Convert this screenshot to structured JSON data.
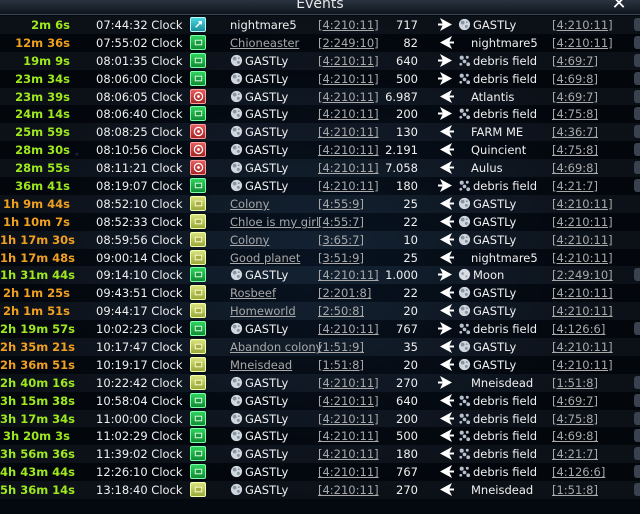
{
  "window": {
    "title": "Events"
  },
  "icons": {
    "close": "close-icon",
    "planet": "planet-icon",
    "debris": "debris-field-icon",
    "moon": "moon-icon",
    "direction": "fleet-direction-icon"
  },
  "colors": {
    "remain_green": "#9ee81e",
    "remain_orange": "#f0a020",
    "link_gray": "#a8a8a8"
  },
  "events": [
    {
      "remain": "2m 6s",
      "color": "green",
      "time": "07:44:32 Clock",
      "mission": "teal",
      "origin": "nightmare5",
      "origin_link": false,
      "origin_icon": false,
      "origin_coord": "[4:210:11]",
      "ships": "717",
      "dir": "out",
      "target": "GASTLy",
      "target_icon": "planet",
      "target_coord": "[4:210:11]",
      "btn": true
    },
    {
      "remain": "12m 36s",
      "color": "orange",
      "time": "07:55:02 Clock",
      "mission": "green",
      "origin": "Chioneaster",
      "origin_link": true,
      "origin_icon": false,
      "origin_coord": "[2:249:10]",
      "ships": "82",
      "dir": "in",
      "target": "nightmare5",
      "target_icon": "",
      "target_coord": "[4:210:11]",
      "btn": true
    },
    {
      "remain": "19m 9s",
      "color": "green",
      "time": "08:01:35 Clock",
      "mission": "green",
      "origin": "GASTLy",
      "origin_link": false,
      "origin_icon": true,
      "origin_coord": "[4:210:11]",
      "ships": "640",
      "dir": "out",
      "target": "debris field",
      "target_icon": "debris",
      "target_coord": "[4:69:7]",
      "btn": true
    },
    {
      "remain": "23m 34s",
      "color": "green",
      "time": "08:06:00 Clock",
      "mission": "green",
      "origin": "GASTLy",
      "origin_link": false,
      "origin_icon": true,
      "origin_coord": "[4:210:11]",
      "ships": "500",
      "dir": "out",
      "target": "debris field",
      "target_icon": "debris",
      "target_coord": "[4:69:8]",
      "btn": true
    },
    {
      "remain": "23m 39s",
      "color": "green",
      "time": "08:06:05 Clock",
      "mission": "red",
      "origin": "GASTLy",
      "origin_link": false,
      "origin_icon": true,
      "origin_coord": "[4:210:11]",
      "ships": "6.987",
      "dir": "in",
      "target": "Atlantis",
      "target_icon": "",
      "target_coord": "[4:69:7]",
      "btn": true
    },
    {
      "remain": "24m 14s",
      "color": "green",
      "time": "08:06:40 Clock",
      "mission": "green",
      "origin": "GASTLy",
      "origin_link": false,
      "origin_icon": true,
      "origin_coord": "[4:210:11]",
      "ships": "200",
      "dir": "out",
      "target": "debris field",
      "target_icon": "debris",
      "target_coord": "[4:75:8]",
      "btn": true
    },
    {
      "remain": "25m 59s",
      "color": "green",
      "time": "08:08:25 Clock",
      "mission": "red",
      "origin": "GASTLy",
      "origin_link": false,
      "origin_icon": true,
      "origin_coord": "[4:210:11]",
      "ships": "130",
      "dir": "in",
      "target": "FARM ME",
      "target_icon": "",
      "target_coord": "[4:36:7]",
      "btn": true
    },
    {
      "remain": "28m 30s",
      "color": "green",
      "time": "08:10:56 Clock",
      "mission": "red",
      "origin": "GASTLy",
      "origin_link": false,
      "origin_icon": true,
      "origin_coord": "[4:210:11]",
      "ships": "2.191",
      "dir": "in",
      "target": "Quincient",
      "target_icon": "",
      "target_coord": "[4:75:8]",
      "btn": true
    },
    {
      "remain": "28m 55s",
      "color": "green",
      "time": "08:11:21 Clock",
      "mission": "red",
      "origin": "GASTLy",
      "origin_link": false,
      "origin_icon": true,
      "origin_coord": "[4:210:11]",
      "ships": "7.058",
      "dir": "in",
      "target": "Aulus",
      "target_icon": "",
      "target_coord": "[4:69:8]",
      "btn": true
    },
    {
      "remain": "36m 41s",
      "color": "green",
      "time": "08:19:07 Clock",
      "mission": "green",
      "origin": "GASTLy",
      "origin_link": false,
      "origin_icon": true,
      "origin_coord": "[4:210:11]",
      "ships": "180",
      "dir": "out",
      "target": "debris field",
      "target_icon": "debris",
      "target_coord": "[4:21:7]",
      "btn": true
    },
    {
      "remain": "1h 9m 44s",
      "color": "orange",
      "time": "08:52:10 Clock",
      "mission": "yellow",
      "origin": "Colony",
      "origin_link": true,
      "origin_icon": false,
      "origin_coord": "[4:55:9]",
      "ships": "25",
      "dir": "in",
      "target": "GASTLy",
      "target_icon": "planet",
      "target_coord": "[4:210:11]",
      "btn": false
    },
    {
      "remain": "1h 10m 7s",
      "color": "orange",
      "time": "08:52:33 Clock",
      "mission": "yellow",
      "origin": "Chloe is my girl",
      "origin_link": true,
      "origin_icon": false,
      "origin_coord": "[4:55:7]",
      "ships": "22",
      "dir": "in",
      "target": "GASTLy",
      "target_icon": "planet",
      "target_coord": "[4:210:11]",
      "btn": false
    },
    {
      "remain": "1h 17m 30s",
      "color": "orange",
      "time": "08:59:56 Clock",
      "mission": "yellow",
      "origin": "Colony",
      "origin_link": true,
      "origin_icon": false,
      "origin_coord": "[3:65:7]",
      "ships": "10",
      "dir": "in",
      "target": "GASTLy",
      "target_icon": "planet",
      "target_coord": "[4:210:11]",
      "btn": false
    },
    {
      "remain": "1h 17m 48s",
      "color": "orange",
      "time": "09:00:14 Clock",
      "mission": "yellow",
      "origin": "Good planet",
      "origin_link": true,
      "origin_icon": false,
      "origin_coord": "[3:51:9]",
      "ships": "25",
      "dir": "in",
      "target": "nightmare5",
      "target_icon": "",
      "target_coord": "[4:210:11]",
      "btn": false
    },
    {
      "remain": "1h 31m 44s",
      "color": "green",
      "time": "09:14:10 Clock",
      "mission": "green",
      "origin": "GASTLy",
      "origin_link": false,
      "origin_icon": true,
      "origin_coord": "[4:210:11]",
      "ships": "1.000",
      "dir": "out",
      "target": "Moon",
      "target_icon": "moon",
      "target_coord": "[2:249:10]",
      "btn": true
    },
    {
      "remain": "2h 1m 25s",
      "color": "orange",
      "time": "09:43:51 Clock",
      "mission": "yellow",
      "origin": "Rosbeef",
      "origin_link": true,
      "origin_icon": false,
      "origin_coord": "[2:201:8]",
      "ships": "22",
      "dir": "in",
      "target": "GASTLy",
      "target_icon": "planet",
      "target_coord": "[4:210:11]",
      "btn": false
    },
    {
      "remain": "2h 1m 51s",
      "color": "orange",
      "time": "09:44:17 Clock",
      "mission": "yellow",
      "origin": "Homeworld",
      "origin_link": true,
      "origin_icon": false,
      "origin_coord": "[2:50:8]",
      "ships": "20",
      "dir": "in",
      "target": "GASTLy",
      "target_icon": "planet",
      "target_coord": "[4:210:11]",
      "btn": false
    },
    {
      "remain": "2h 19m 57s",
      "color": "green",
      "time": "10:02:23 Clock",
      "mission": "green",
      "origin": "GASTLy",
      "origin_link": false,
      "origin_icon": true,
      "origin_coord": "[4:210:11]",
      "ships": "767",
      "dir": "out",
      "target": "debris field",
      "target_icon": "debris",
      "target_coord": "[4:126:6]",
      "btn": true
    },
    {
      "remain": "2h 35m 21s",
      "color": "orange",
      "time": "10:17:47 Clock",
      "mission": "yellow",
      "origin": "Abandon colony",
      "origin_link": true,
      "origin_icon": false,
      "origin_coord": "[1:51:9]",
      "ships": "35",
      "dir": "in",
      "target": "GASTLy",
      "target_icon": "planet",
      "target_coord": "[4:210:11]",
      "btn": false
    },
    {
      "remain": "2h 36m 51s",
      "color": "orange",
      "time": "10:19:17 Clock",
      "mission": "yellow",
      "origin": "Mneisdead",
      "origin_link": true,
      "origin_icon": false,
      "origin_coord": "[1:51:8]",
      "ships": "20",
      "dir": "in",
      "target": "GASTLy",
      "target_icon": "planet",
      "target_coord": "[4:210:11]",
      "btn": false
    },
    {
      "remain": "2h 40m 16s",
      "color": "green",
      "time": "10:22:42 Clock",
      "mission": "yellow",
      "origin": "GASTLy",
      "origin_link": false,
      "origin_icon": true,
      "origin_coord": "[4:210:11]",
      "ships": "270",
      "dir": "out",
      "target": "Mneisdead",
      "target_icon": "",
      "target_coord": "[1:51:8]",
      "btn": true
    },
    {
      "remain": "3h 15m 38s",
      "color": "green",
      "time": "10:58:04 Clock",
      "mission": "green",
      "origin": "GASTLy",
      "origin_link": false,
      "origin_icon": true,
      "origin_coord": "[4:210:11]",
      "ships": "640",
      "dir": "in",
      "target": "debris field",
      "target_icon": "debris",
      "target_coord": "[4:69:7]",
      "btn": true
    },
    {
      "remain": "3h 17m 34s",
      "color": "green",
      "time": "11:00:00 Clock",
      "mission": "green",
      "origin": "GASTLy",
      "origin_link": false,
      "origin_icon": true,
      "origin_coord": "[4:210:11]",
      "ships": "200",
      "dir": "in",
      "target": "debris field",
      "target_icon": "debris",
      "target_coord": "[4:75:8]",
      "btn": true
    },
    {
      "remain": "3h 20m 3s",
      "color": "green",
      "time": "11:02:29 Clock",
      "mission": "green",
      "origin": "GASTLy",
      "origin_link": false,
      "origin_icon": true,
      "origin_coord": "[4:210:11]",
      "ships": "500",
      "dir": "in",
      "target": "debris field",
      "target_icon": "debris",
      "target_coord": "[4:69:8]",
      "btn": true
    },
    {
      "remain": "3h 56m 36s",
      "color": "green",
      "time": "11:39:02 Clock",
      "mission": "green",
      "origin": "GASTLy",
      "origin_link": false,
      "origin_icon": true,
      "origin_coord": "[4:210:11]",
      "ships": "180",
      "dir": "in",
      "target": "debris field",
      "target_icon": "debris",
      "target_coord": "[4:21:7]",
      "btn": true
    },
    {
      "remain": "4h 43m 44s",
      "color": "green",
      "time": "12:26:10 Clock",
      "mission": "green",
      "origin": "GASTLy",
      "origin_link": false,
      "origin_icon": true,
      "origin_coord": "[4:210:11]",
      "ships": "767",
      "dir": "in",
      "target": "debris field",
      "target_icon": "debris",
      "target_coord": "[4:126:6]",
      "btn": true
    },
    {
      "remain": "5h 36m 14s",
      "color": "green",
      "time": "13:18:40 Clock",
      "mission": "yellow",
      "origin": "GASTLy",
      "origin_link": false,
      "origin_icon": true,
      "origin_coord": "[4:210:11]",
      "ships": "270",
      "dir": "in",
      "target": "Mneisdead",
      "target_icon": "",
      "target_coord": "[1:51:8]",
      "btn": true
    }
  ]
}
